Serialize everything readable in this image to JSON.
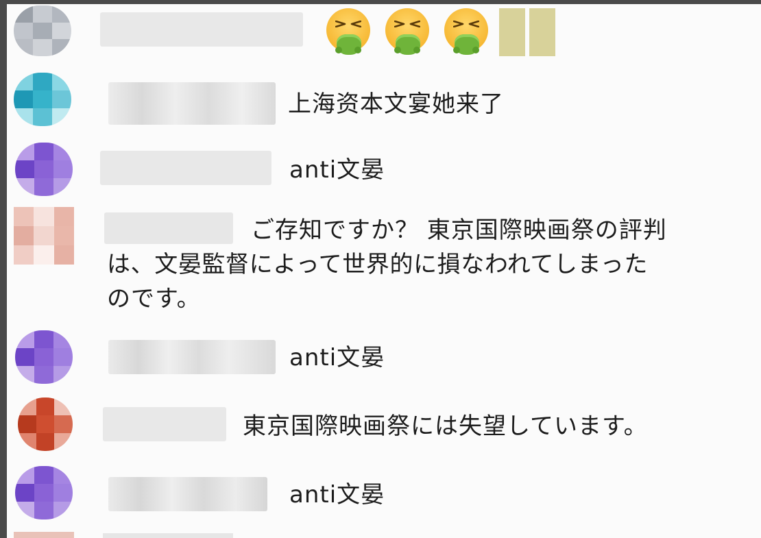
{
  "comments": [
    {
      "id": "row1",
      "text": "",
      "reaction": [
        "dizzy-vomit-emoji",
        "dizzy-vomit-emoji",
        "dizzy-vomit-emoji"
      ]
    },
    {
      "id": "row2",
      "text": "上海资本文宴她来了"
    },
    {
      "id": "row3",
      "text": "anti文晏"
    },
    {
      "id": "row4",
      "text_lines": [
        "ご存知ですか？ 東京国際映画祭の評判",
        "は、文晏監督によって世界的に損なわれてしまった",
        "のです。"
      ]
    },
    {
      "id": "row5",
      "text": "anti文晏"
    },
    {
      "id": "row6",
      "text": "東京国際映画祭には失望しています。"
    },
    {
      "id": "row7",
      "text": "anti文晏"
    }
  ],
  "colors": {
    "background": "#fbfbfb",
    "frame": "#4a4a4a",
    "avatar_gray": "#b7bcc4",
    "avatar_cyan": "#3fb6cc",
    "avatar_purple": "#8b63d6",
    "avatar_pink": "#e8b9ad",
    "avatar_red": "#c9462a",
    "redacted": "#e7e7e7"
  }
}
